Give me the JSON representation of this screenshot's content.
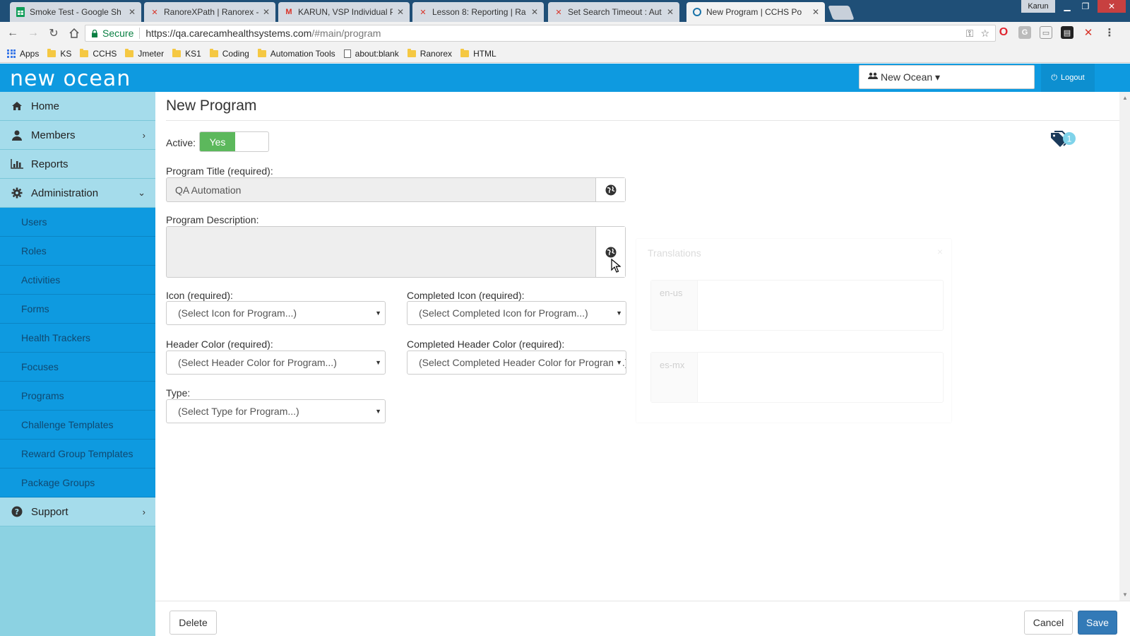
{
  "browser": {
    "tabs": [
      {
        "title": "Smoke Test - Google Sh",
        "favicon": "sheets-icon"
      },
      {
        "title": "RanoreXPath | Ranorex -",
        "favicon": "ranorex-icon"
      },
      {
        "title": "KARUN, VSP Individual P",
        "favicon": "gmail-icon"
      },
      {
        "title": "Lesson 8: Reporting | Ra",
        "favicon": "ranorex-icon"
      },
      {
        "title": "Set Search Timeout : Aut",
        "favicon": "ranorex-icon"
      },
      {
        "title": "New Program | CCHS Po",
        "favicon": "cchs-icon"
      }
    ],
    "user": "Karun",
    "secure_label": "Secure",
    "url_host": "https://qa.carecamhealthsystems.com",
    "url_path": "/#main/program",
    "bookmarks": [
      {
        "label": "Apps",
        "type": "apps"
      },
      {
        "label": "KS",
        "type": "folder"
      },
      {
        "label": "CCHS",
        "type": "folder"
      },
      {
        "label": "Jmeter",
        "type": "folder"
      },
      {
        "label": "KS1",
        "type": "folder"
      },
      {
        "label": "Coding",
        "type": "folder"
      },
      {
        "label": "Automation Tools",
        "type": "folder"
      },
      {
        "label": "about:blank",
        "type": "page"
      },
      {
        "label": "Ranorex",
        "type": "folder"
      },
      {
        "label": "HTML",
        "type": "folder"
      }
    ]
  },
  "header": {
    "logo": "new ocean",
    "org_select": "New Ocean ▾",
    "logout": "Logout"
  },
  "sidebar": {
    "items": [
      {
        "label": "Home",
        "icon": "home-icon"
      },
      {
        "label": "Members",
        "icon": "user-icon",
        "chevron": "›"
      },
      {
        "label": "Reports",
        "icon": "bar-chart-icon"
      },
      {
        "label": "Administration",
        "icon": "gear-icon",
        "chevron": "⌄"
      }
    ],
    "sub_items": [
      "Users",
      "Roles",
      "Activities",
      "Forms",
      "Health Trackers",
      "Focuses",
      "Programs",
      "Challenge Templates",
      "Reward Group Templates",
      "Package Groups"
    ],
    "support": {
      "label": "Support",
      "icon": "question-icon",
      "chevron": "›"
    }
  },
  "page": {
    "title": "New Program",
    "active_label": "Active:",
    "active_value": "Yes",
    "tag_count": "1",
    "program_title_label": "Program Title (required):",
    "program_title_value": "QA Automation",
    "program_description_label": "Program Description:",
    "program_description_value": "",
    "icon_label": "Icon (required):",
    "icon_select": "(Select Icon for Program...)",
    "completed_icon_label": "Completed Icon (required):",
    "completed_icon_select": "(Select Completed Icon for Program...)",
    "header_color_label": "Header Color (required):",
    "header_color_select": "(Select Header Color for Program...)",
    "completed_header_color_label": "Completed Header Color (required):",
    "completed_header_color_select": "(Select Completed Header Color for Program...)",
    "type_label": "Type:",
    "type_select": "(Select Type for Program...)"
  },
  "translations": {
    "title": "Translations",
    "close": "×",
    "rows": [
      {
        "lang": "en-us"
      },
      {
        "lang": "es-mx"
      }
    ]
  },
  "footer": {
    "delete": "Delete",
    "cancel": "Cancel",
    "save": "Save"
  },
  "colors": {
    "brand_blue": "#0e9ae0",
    "sidebar_bg": "#8cd2e2",
    "toggle_on": "#5cb85c",
    "primary_button": "#337ab7"
  }
}
